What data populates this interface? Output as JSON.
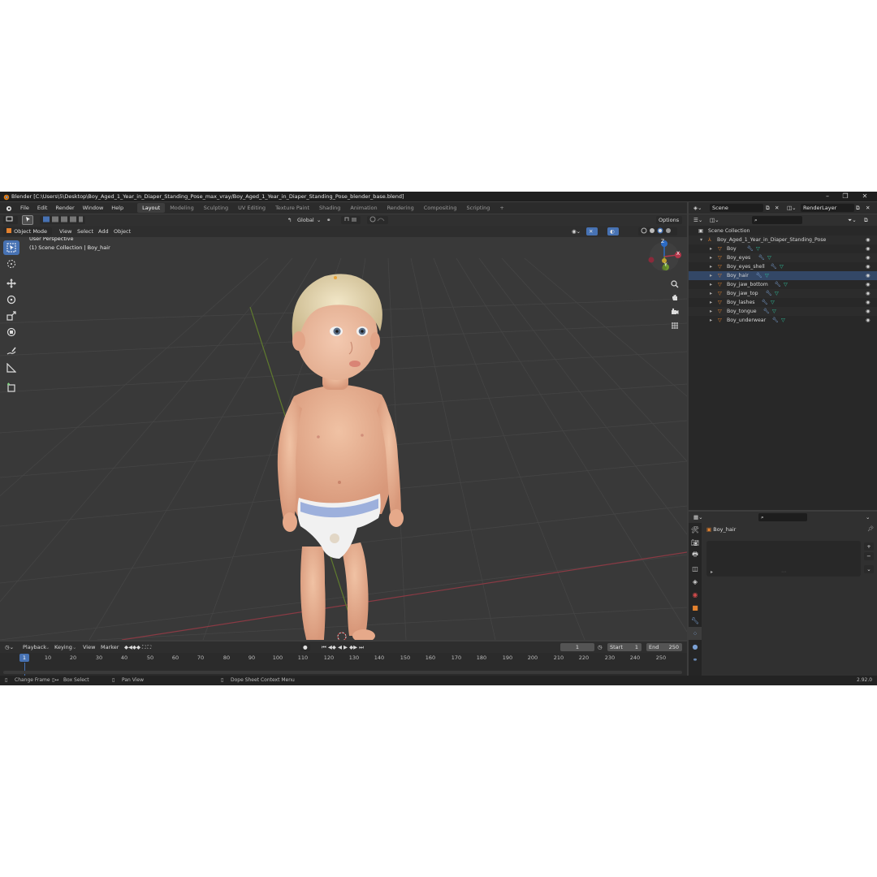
{
  "window": {
    "title": "Blender [C:\\Users\\5\\Desktop\\Boy_Aged_1_Year_in_Diaper_Standing_Pose_max_vray/Boy_Aged_1_Year_in_Diaper_Standing_Pose_blender_base.blend]",
    "minimize": "–",
    "maximize": "❐",
    "close": "✕"
  },
  "menu": [
    "File",
    "Edit",
    "Render",
    "Window",
    "Help"
  ],
  "workspaces": [
    "Layout",
    "Modeling",
    "Sculpting",
    "UV Editing",
    "Texture Paint",
    "Shading",
    "Animation",
    "Rendering",
    "Compositing",
    "Scripting",
    "+"
  ],
  "active_workspace": "Layout",
  "scene": {
    "scene_name": "Scene",
    "view_layer": "RenderLayer"
  },
  "header": {
    "mode": "Object Mode",
    "menus": [
      "View",
      "Select",
      "Add",
      "Object"
    ],
    "orientation": "Global",
    "options": "Options"
  },
  "viewport": {
    "perspective": "User Perspective",
    "collection": "(1) Scene Collection | Boy_hair",
    "gizmo_axes": [
      "X",
      "Y",
      "Z"
    ]
  },
  "timeline": {
    "menus": [
      "Playback",
      "Keying",
      "View",
      "Marker"
    ],
    "current_frame": "1",
    "start_label": "Start",
    "start": "1",
    "end_label": "End",
    "end": "250",
    "ticks": [
      "1",
      "10",
      "20",
      "30",
      "40",
      "50",
      "60",
      "70",
      "80",
      "90",
      "100",
      "110",
      "120",
      "130",
      "140",
      "150",
      "160",
      "170",
      "180",
      "190",
      "200",
      "210",
      "220",
      "230",
      "240",
      "250"
    ]
  },
  "status": {
    "change_frame": "Change Frame",
    "box_select": "Box Select",
    "pan_view": "Pan View",
    "context_menu": "Dope Sheet Context Menu",
    "version": "2.92.0"
  },
  "outliner": {
    "root": "Scene Collection",
    "collection": "Boy_Aged_1_Year_in_Diaper_Standing_Pose",
    "objects": [
      "Boy",
      "Boy_eyes",
      "Boy_eyes_shell",
      "Boy_hair",
      "Boy_jaw_bottom",
      "Boy_jaw_top",
      "Boy_lashes",
      "Boy_tongue",
      "Boy_underwear"
    ]
  },
  "properties": {
    "object_name": "Boy_hair"
  },
  "colors": {
    "accent": "#4772b3",
    "x_axis": "#b3364a",
    "y_axis": "#6f9a2e",
    "z_axis": "#2c6bc4",
    "mesh_icon": "#e3812e",
    "modifier_icon": "#7aa0d4",
    "mesh_data_icon": "#2fc39f"
  }
}
